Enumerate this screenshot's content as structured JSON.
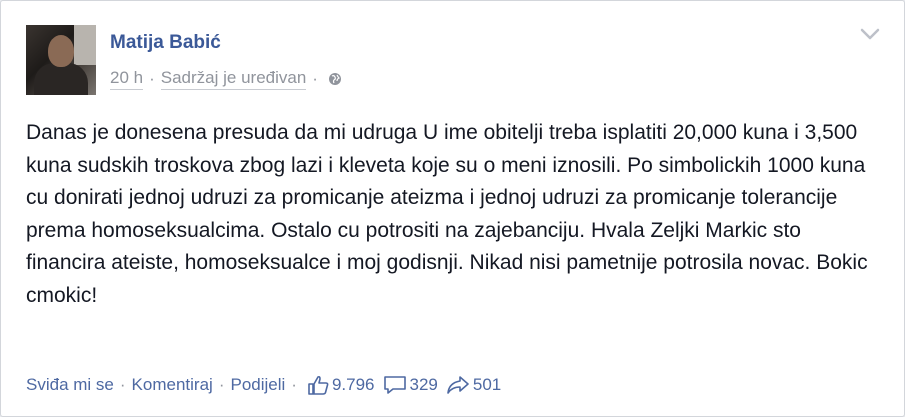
{
  "post": {
    "author": "Matija Babić",
    "time": "20 h",
    "edited": "Sadržaj je uređivan",
    "separator": "·",
    "text": "Danas je donesena presuda da mi udruga U ime obitelji treba isplatiti 20,000 kuna i 3,500 kuna sudskih troskova zbog lazi i kleveta koje su o meni iznosili. Po simbolickih 1000 kuna cu donirati jednoj udruzi za promicanje ateizma i jednoj udruzi za promicanje tolerancije prema homoseksualcima. Ostalo cu potrositi na zajebanciju. Hvala Zeljki Markic sto financira ateiste, homoseksualce i moj godisnji. Nikad nisi pametnije potrosila novac. Bokic cmokic!",
    "privacy_icon": "globe-icon",
    "menu_icon": "chevron-down-icon"
  },
  "actions": {
    "like": "Sviđa mi se",
    "comment": "Komentiraj",
    "share": "Podijeli",
    "separator": "·"
  },
  "stats": {
    "likes": "9.796",
    "comments": "329",
    "shares": "501"
  },
  "colors": {
    "link": "#3b5998",
    "action": "#4e69a2",
    "meta": "#90949c",
    "text": "#141823"
  }
}
